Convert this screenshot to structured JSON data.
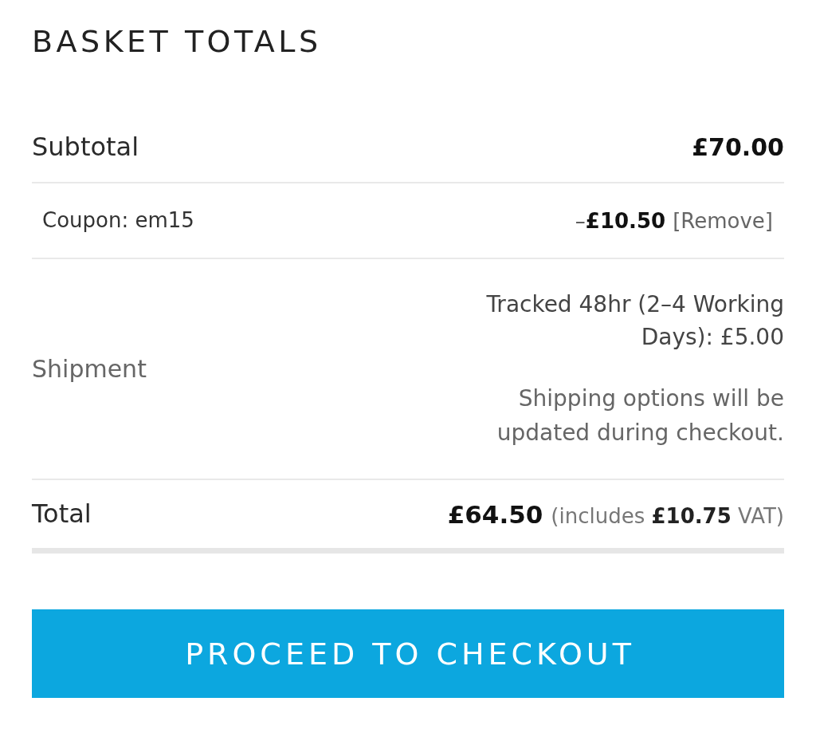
{
  "heading": "BASKET TOTALS",
  "rows": [
    {
      "kind": "subtotal",
      "label": "Subtotal",
      "amount": "£70.00"
    },
    {
      "kind": "coupon",
      "label": "Coupon: em15",
      "amount": "–**£10.50**",
      "action": "[Remove]"
    },
    {
      "kind": "shipment",
      "label": "Shipment",
      "method": "Tracked 48hr (2–4 Working Days): £5.00",
      "note": "Shipping options will be updated during checkout."
    },
    {
      "kind": "total",
      "label": "Total",
      "amount": "£64.50",
      "note": "(includes **£10.75** VAT)"
    }
  ],
  "button": {
    "label": "PROCEED TO CHECKOUT"
  }
}
